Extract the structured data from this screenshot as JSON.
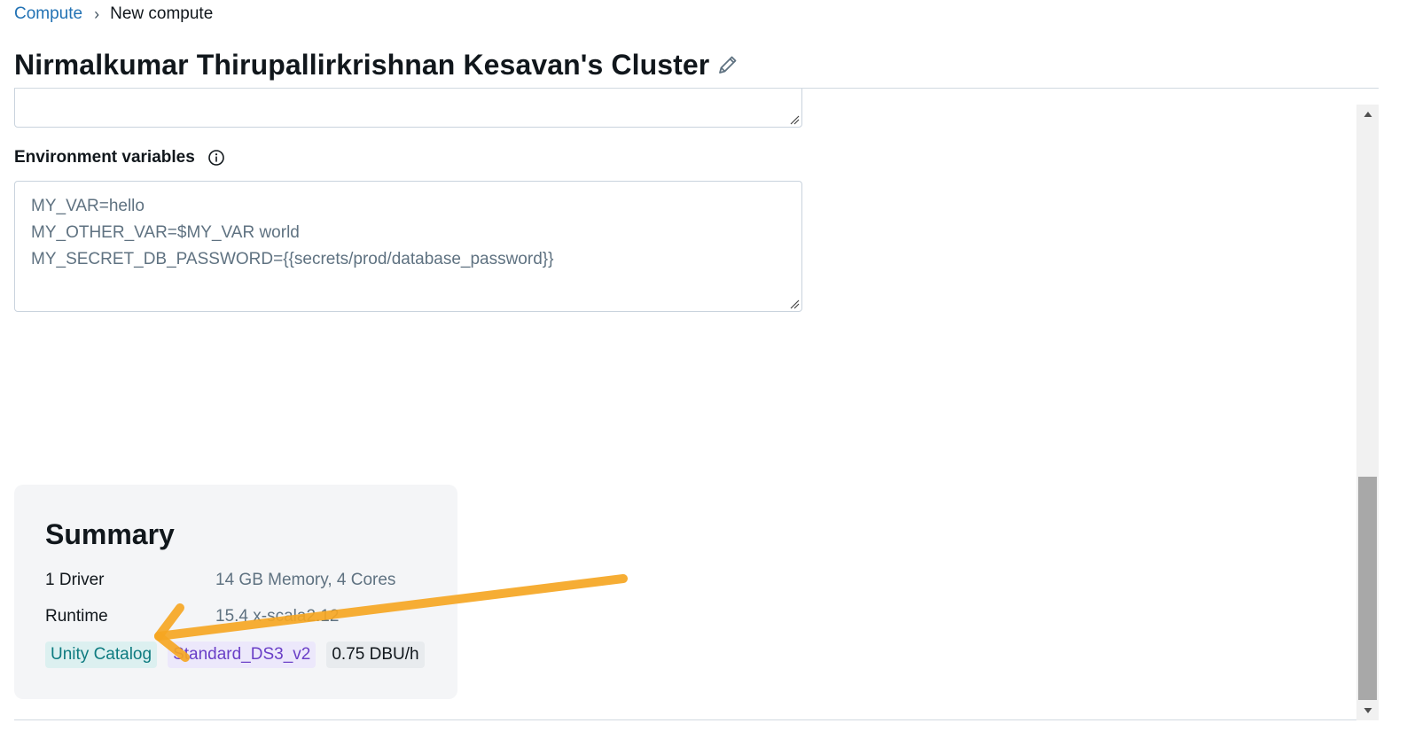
{
  "breadcrumb": {
    "parent": "Compute",
    "separator": "›",
    "current": "New compute"
  },
  "title": {
    "text": "Nirmalkumar Thirupallirkrishnan Kesavan's Cluster",
    "edit_icon": "pencil-icon"
  },
  "env": {
    "label": "Environment variables",
    "info_icon": "info-circle-icon",
    "lines": [
      "MY_VAR=hello",
      "MY_OTHER_VAR=$MY_VAR world",
      "MY_SECRET_DB_PASSWORD={{secrets/prod/database_password}}"
    ]
  },
  "summary": {
    "title": "Summary",
    "driver_label": "1 Driver",
    "driver_value": "14 GB Memory, 4 Cores",
    "runtime_label": "Runtime",
    "runtime_value": "15.4 x-scala2.12",
    "tags": [
      "Unity Catalog",
      "Standard_DS3_v2",
      "0.75 DBU/h"
    ]
  },
  "colors": {
    "link": "#2272b4",
    "annotation_arrow": "#f5a623",
    "tag_unity_catalog": "#0e7b80",
    "tag_node_type": "#6a3fc7"
  }
}
